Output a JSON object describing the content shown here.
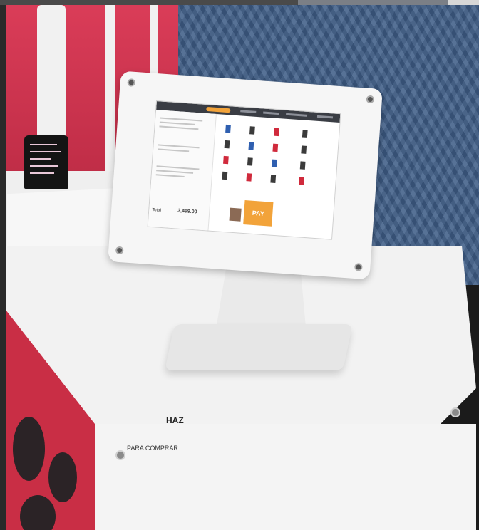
{
  "pos_screen": {
    "pay_label": "PAY",
    "total_label": "Total",
    "total_amount": "3,499.00"
  },
  "caption": {
    "heading": "HAZ",
    "subtext": "PARA COMPRAR"
  },
  "colors": {
    "accent_orange": "#f2a33a",
    "wall_red": "#d8324f",
    "sweater_blue": "#3e5c86"
  }
}
